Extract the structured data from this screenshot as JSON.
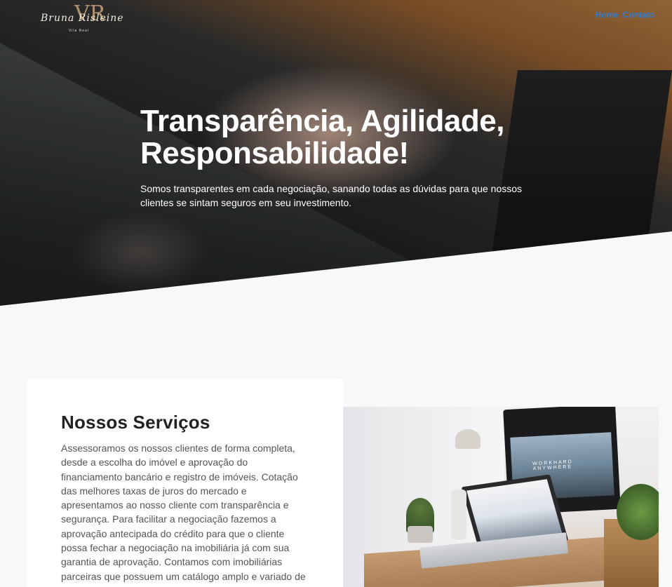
{
  "brand": {
    "logo_script": "Bruna Risleine",
    "logo_monogram": "VR",
    "logo_sub": "Vila Real"
  },
  "nav": {
    "items": [
      "Home",
      "Contato"
    ]
  },
  "hero": {
    "title": "Transparência, Agilidade, Responsabilidade!",
    "text": "Somos transparentes em cada negociação, sanando todas as dúvidas para que nossos clientes se sintam seguros em seu investimento."
  },
  "services": {
    "title": "Nossos Serviços",
    "text": "Assessoramos os nossos clientes de forma completa, desde a escolha do imóvel e aprovação do financiamento bancário e registro de imóveis. Cotação das melhores taxas de juros do mercado e apresentamos ao nosso cliente com transparência e segurança. Para facilitar a negociação fazemos a aprovação antecipada do crédito para que o cliente possa fechar a negociação na imobiliária já com sua garantia de aprovação. Contamos com imobiliárias parceiras que possuem um catálogo amplo e variado de imóveis em diversas regiões. Assim",
    "photo_screen_text": "WORKHARD ANYWHERE"
  },
  "colors": {
    "nav_link": "#2f7fd8",
    "page_bg": "#f7f8fa"
  }
}
